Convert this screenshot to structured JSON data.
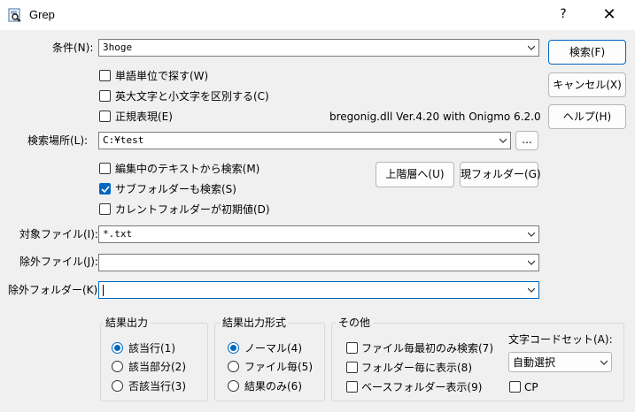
{
  "window": {
    "title": "Grep",
    "help_glyph": "?",
    "close_glyph": "✕"
  },
  "form": {
    "condition": {
      "label": "条件(N):",
      "value": "3hoge"
    },
    "options": [
      {
        "label": "単語単位で探す(W)",
        "checked": false
      },
      {
        "label": "英大文字と小文字を区別する(C)",
        "checked": false
      },
      {
        "label": "正規表現(E)",
        "checked": false
      }
    ],
    "regex_lib": "bregonig.dll Ver.4.20 with Onigmo 6.2.0",
    "location": {
      "label": "検索場所(L):",
      "value": "C:¥test",
      "browse": "..."
    },
    "location_options": [
      {
        "label": "編集中のテキストから検索(M)",
        "checked": false
      },
      {
        "label": "サブフォルダーも検索(S)",
        "checked": true
      },
      {
        "label": "カレントフォルダーが初期値(D)",
        "checked": false
      }
    ],
    "up_button": "上階層へ(U)",
    "current_folder_button": "現フォルダー(G)",
    "target_files": {
      "label": "対象ファイル(I):",
      "value": "*.txt"
    },
    "exclude_files": {
      "label": "除外ファイル(J):",
      "value": ""
    },
    "exclude_folders": {
      "label": "除外フォルダー(K):",
      "value": ""
    }
  },
  "buttons": {
    "search": "検索(F)",
    "cancel": "キャンセル(X)",
    "help": "ヘルプ(H)"
  },
  "result_output": {
    "title": "結果出力",
    "options": [
      {
        "label": "該当行(1)",
        "selected": true
      },
      {
        "label": "該当部分(2)",
        "selected": false
      },
      {
        "label": "否該当行(3)",
        "selected": false
      }
    ]
  },
  "result_format": {
    "title": "結果出力形式",
    "options": [
      {
        "label": "ノーマル(4)",
        "selected": true
      },
      {
        "label": "ファイル毎(5)",
        "selected": false
      },
      {
        "label": "結果のみ(6)",
        "selected": false
      }
    ]
  },
  "other": {
    "title": "その他",
    "options": [
      {
        "label": "ファイル毎最初のみ検索(7)",
        "checked": false
      },
      {
        "label": "フォルダー毎に表示(8)",
        "checked": false
      },
      {
        "label": "ベースフォルダー表示(9)",
        "checked": false
      }
    ],
    "charset_label": "文字コードセット(A):",
    "charset_value": "自動選択",
    "cp_label": "CP",
    "cp_checked": false
  },
  "colors": {
    "accent": "#0067c0",
    "background": "#f0f0f0",
    "titlebar": "#ffffff"
  }
}
